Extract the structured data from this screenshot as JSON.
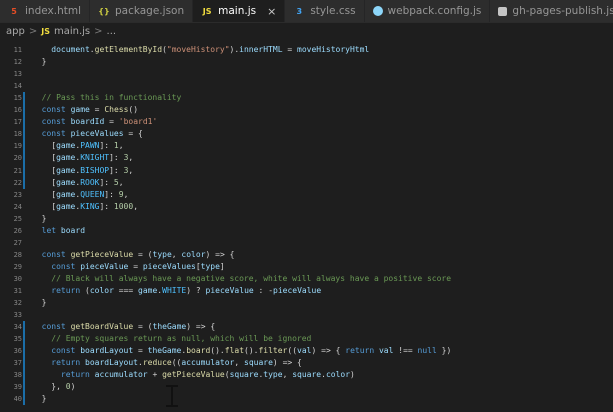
{
  "tabs": [
    {
      "label": "index.html",
      "icon": "html-file-icon",
      "active": false
    },
    {
      "label": "package.json",
      "icon": "json-file-icon",
      "active": false
    },
    {
      "label": "main.js",
      "icon": "js-file-icon",
      "active": true,
      "close": "×"
    },
    {
      "label": "style.css",
      "icon": "css-file-icon",
      "active": false
    },
    {
      "label": "webpack.config.js",
      "icon": "webpack-icon",
      "active": false
    },
    {
      "label": "gh-pages-publish.js",
      "icon": "gh-pages-file-icon",
      "active": false
    }
  ],
  "icon_glyphs": {
    "html": "5",
    "json": "{}",
    "js": "JS",
    "css": "3"
  },
  "breadcrumb": {
    "folder": "app",
    "sep": ">",
    "js_glyph": "JS",
    "file": "main.js",
    "sep2": ">",
    "more": "..."
  },
  "lines": [
    {
      "num": "11",
      "text": "    document.getElementById(\"moveHistory\").innerHTML = moveHistoryHtml"
    },
    {
      "num": "12",
      "text": "  }"
    },
    {
      "num": "13",
      "text": ""
    },
    {
      "num": "14",
      "text": ""
    },
    {
      "num": "15",
      "text": "  // Pass this in functionality"
    },
    {
      "num": "16",
      "text": "  const game = Chess()"
    },
    {
      "num": "17",
      "text": "  const boardId = 'board1'"
    },
    {
      "num": "18",
      "text": "  const pieceValues = {"
    },
    {
      "num": "19",
      "text": "    [game.PAWN]: 1,"
    },
    {
      "num": "20",
      "text": "    [game.KNIGHT]: 3,"
    },
    {
      "num": "21",
      "text": "    [game.BISHOP]: 3,"
    },
    {
      "num": "22",
      "text": "    [game.ROOK]: 5,"
    },
    {
      "num": "23",
      "text": "    [game.QUEEN]: 9,"
    },
    {
      "num": "24",
      "text": "    [game.KING]: 1000,"
    },
    {
      "num": "25",
      "text": "  }"
    },
    {
      "num": "26",
      "text": "  let board"
    },
    {
      "num": "27",
      "text": ""
    },
    {
      "num": "28",
      "text": "  const getPieceValue = (type, color) => {"
    },
    {
      "num": "29",
      "text": "    const pieceValue = pieceValues[type]"
    },
    {
      "num": "30",
      "text": "    // Black will always have a negative score, white will always have a positive score"
    },
    {
      "num": "31",
      "text": "    return (color === game.WHITE) ? pieceValue : -pieceValue"
    },
    {
      "num": "32",
      "text": "  }"
    },
    {
      "num": "33",
      "text": ""
    },
    {
      "num": "34",
      "text": "  const getBoardValue = (theGame) => {"
    },
    {
      "num": "35",
      "text": "    // Empty squares return as null, which will be ignored"
    },
    {
      "num": "36",
      "text": "    const boardLayout = theGame.board().flat().filter((val) => { return val !== null })"
    },
    {
      "num": "37",
      "text": "    return boardLayout.reduce((accumulator, square) => {"
    },
    {
      "num": "38",
      "text": "      return accumulator + getPieceValue(square.type, square.color)"
    },
    {
      "num": "39",
      "text": "    }, 0)"
    },
    {
      "num": "40",
      "text": "  }"
    }
  ],
  "colors": {
    "editor_bg": "#1e1e1e",
    "tab_bar_bg": "#252526",
    "keyword": "#569cd6",
    "variable": "#9cdcfe",
    "constant": "#4fc1ff",
    "function": "#dcdcaa",
    "string": "#ce9178",
    "number": "#b5cea8",
    "comment": "#6a9955",
    "gutter_modified": "#1b6ea8"
  }
}
